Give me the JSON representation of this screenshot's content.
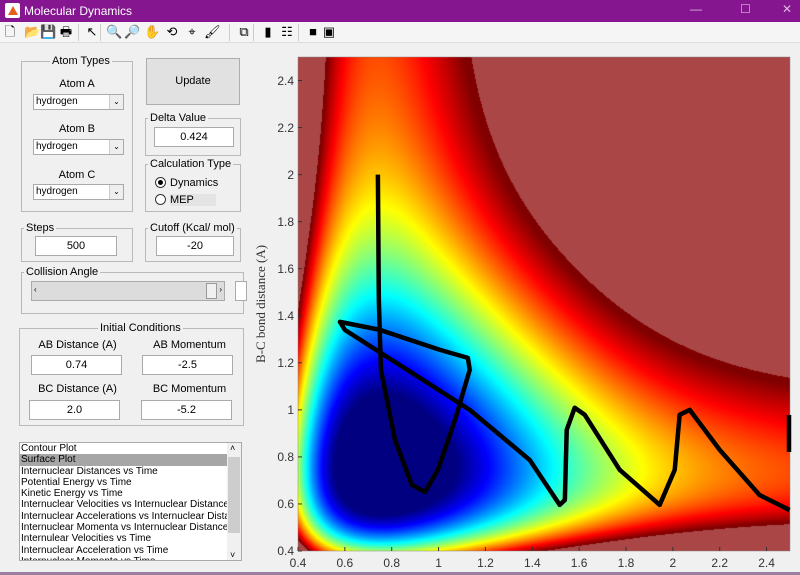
{
  "window": {
    "title": "Molecular Dynamics",
    "min": "—",
    "max": "☐",
    "close": "✕"
  },
  "toolbar": [
    {
      "icon": "new-file-icon",
      "g": "🗋"
    },
    {
      "icon": "open-folder-icon",
      "g": "📂"
    },
    {
      "icon": "save-icon",
      "g": "💾"
    },
    {
      "icon": "print-icon",
      "g": "🖶"
    },
    {
      "icon": "pointer-icon",
      "g": "↖"
    },
    {
      "icon": "zoom-in-icon",
      "g": "🔍"
    },
    {
      "icon": "zoom-out-icon",
      "g": "🔎"
    },
    {
      "icon": "pan-icon",
      "g": "✋"
    },
    {
      "icon": "rotate-3d-icon",
      "g": "⟲"
    },
    {
      "icon": "data-cursor-icon",
      "g": "⌖"
    },
    {
      "icon": "brush-icon",
      "g": "🖌"
    },
    {
      "icon": "link-plot-icon",
      "g": "⧉"
    },
    {
      "icon": "colorbar-icon",
      "g": "▮"
    },
    {
      "icon": "legend-icon",
      "g": "☷"
    },
    {
      "icon": "hide-plot-tools-icon",
      "g": "■"
    },
    {
      "icon": "show-plot-tools-icon",
      "g": "▣"
    }
  ],
  "atom_types": {
    "title": "Atom Types",
    "a_label": "Atom A",
    "a_value": "hydrogen",
    "b_label": "Atom B",
    "b_value": "hydrogen",
    "c_label": "Atom C",
    "c_value": "hydrogen"
  },
  "update_label": "Update",
  "delta": {
    "label": "Delta Value",
    "value": "0.424"
  },
  "calc_type": {
    "label": "Calculation Type",
    "options": [
      "Dynamics",
      "MEP"
    ],
    "selected": "Dynamics"
  },
  "steps": {
    "label": "Steps",
    "value": "500"
  },
  "cutoff": {
    "label": "Cutoff (Kcal/ mol)",
    "value": "-20"
  },
  "collision_angle": {
    "label": "Collision Angle",
    "slider_value": 0.98
  },
  "initial": {
    "title": "Initial Conditions",
    "ab_dist_label": "AB Distance (A)",
    "ab_dist": "0.74",
    "ab_mom_label": "AB Momentum",
    "ab_mom": "-2.5",
    "bc_dist_label": "BC Distance (A)",
    "bc_dist": "2.0",
    "bc_mom_label": "BC Momentum",
    "bc_mom": "-5.2"
  },
  "plot_list": {
    "items": [
      "Contour Plot",
      "Surface Plot",
      "Internuclear Distances vs Time",
      "Potential Energy vs Time",
      "Kinetic Energy vs Time",
      "Internuclear Velocities vs Internuclear Distance",
      "Internuclear Accelerations vs Internuclear Distance",
      "Internuclear Momenta vs Internuclear Distance",
      "Internulear Velocities vs Time",
      "Internuclear Acceleration vs Time",
      "Internuclear Momenta vs Time"
    ],
    "selected": "Surface Plot"
  },
  "chart_data": {
    "type": "heatmap",
    "ylabel": "B-C bond distance (A)",
    "xlabel": "",
    "xlim": [
      0.4,
      2.5
    ],
    "ylim": [
      0.4,
      2.5
    ],
    "xticks": [
      "0.4",
      "0.6",
      "0.8",
      "1",
      "1.2",
      "1.4",
      "1.6",
      "1.8",
      "2",
      "2.2",
      "2.4"
    ],
    "yticks": [
      "0.4",
      "0.6",
      "0.8",
      "1",
      "1.2",
      "1.4",
      "1.6",
      "1.8",
      "2",
      "2.2",
      "2.4"
    ],
    "colormap": "jet",
    "trajectory_color": "#000000",
    "trajectory": [
      [
        0.741,
        2.0
      ],
      [
        0.745,
        1.468
      ],
      [
        0.754,
        1.17
      ],
      [
        0.814,
        0.872
      ],
      [
        0.886,
        0.681
      ],
      [
        0.942,
        0.651
      ],
      [
        0.997,
        0.745
      ],
      [
        1.07,
        0.957
      ],
      [
        1.133,
        1.17
      ],
      [
        1.125,
        1.221
      ],
      [
        1.006,
        1.255
      ],
      [
        0.75,
        1.34
      ],
      [
        0.579,
        1.374
      ],
      [
        0.6,
        1.34
      ],
      [
        0.835,
        1.19
      ],
      [
        1.133,
        1.0
      ],
      [
        1.389,
        0.787
      ],
      [
        1.517,
        0.596
      ],
      [
        1.539,
        0.617
      ],
      [
        1.547,
        0.915
      ],
      [
        1.581,
        1.009
      ],
      [
        1.624,
        0.979
      ],
      [
        1.773,
        0.745
      ],
      [
        1.944,
        0.596
      ],
      [
        2.008,
        0.745
      ],
      [
        2.029,
        0.979
      ],
      [
        2.072,
        1.0
      ],
      [
        2.2,
        0.83
      ],
      [
        2.37,
        0.638
      ],
      [
        2.498,
        0.574
      ]
    ]
  }
}
